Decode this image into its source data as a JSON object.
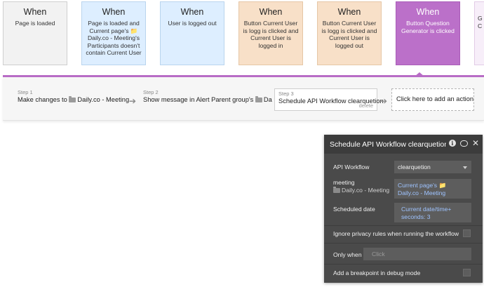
{
  "events": [
    {
      "when": "When",
      "desc": "Page is loaded"
    },
    {
      "when": "When",
      "desc": "Page is loaded and Current page's 📁 Daily.co - Meeting's Participants doesn't contain Current User"
    },
    {
      "when": "When",
      "desc": "User is logged out"
    },
    {
      "when": "When",
      "desc": "Button Current User is logg is clicked and Current User is logged in"
    },
    {
      "when": "When",
      "desc": "Button Current User is logg is clicked and Current User is logged out"
    },
    {
      "when": "When",
      "desc": "Button Question Generator is clicked"
    },
    {
      "when": "",
      "desc": "G an D C"
    }
  ],
  "workflow": {
    "steps": [
      {
        "num": "Step 1",
        "title_prefix": "Make changes to",
        "title": "Daily.co - Meeting..."
      },
      {
        "num": "Step 2",
        "title_prefix": "Show message in Alert Parent group's",
        "title": "Da"
      },
      {
        "num": "Step 3",
        "title": "Schedule API Workflow clearquetion",
        "delete": "delete"
      }
    ],
    "add_action": "Click here to add an action..."
  },
  "panel": {
    "title": "Schedule API Workflow clearquetion",
    "api_workflow_label": "API Workflow",
    "api_workflow_value": "clearquetion",
    "meeting_label": "meeting",
    "meeting_type": "Daily.co - Meeting",
    "meeting_value": "Current page's 📁 Daily.co - Meeting",
    "scheduled_label": "Scheduled date",
    "scheduled_value": "Current date/time+ seconds: 3",
    "ignore_privacy_label": "Ignore privacy rules when running the workflow",
    "ignore_privacy_checked": false,
    "only_when_label": "Only when",
    "only_when_placeholder": "Click",
    "breakpoint_label": "Add a breakpoint in debug mode",
    "breakpoint_checked": false
  },
  "colors": {
    "accent_purple": "#bb70c9",
    "card_blue": "#ddeeff",
    "card_orange": "#f8e0c8",
    "panel_bg": "#4a4a4a",
    "link_blue": "#9ec3ff"
  }
}
